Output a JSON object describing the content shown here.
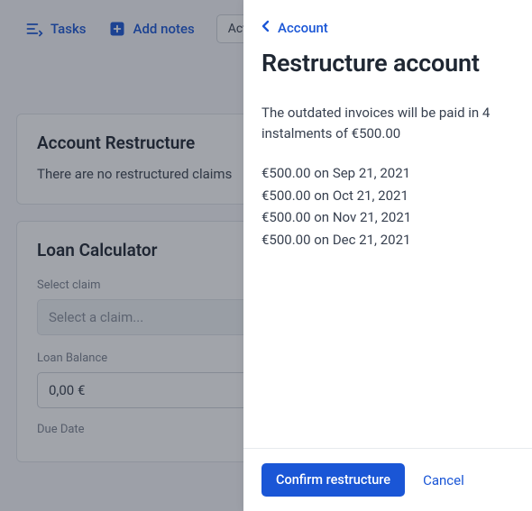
{
  "topbar": {
    "tasks_label": "Tasks",
    "add_notes_label": "Add notes",
    "action_label": "Act"
  },
  "restructure_card": {
    "title": "Account Restructure",
    "empty": "There are no restructured claims"
  },
  "loan_card": {
    "title": "Loan Calculator",
    "select_claim_label": "Select claim",
    "select_claim_placeholder": "Select a claim...",
    "loan_balance_label": "Loan Balance",
    "loan_balance_value": "0,00 €",
    "due_date_label": "Due Date"
  },
  "panel": {
    "breadcrumb": "Account",
    "title": "Restructure account",
    "description": "The outdated invoices will be paid in 4 instalments of €500.00",
    "schedule": [
      "€500.00 on Sep 21, 2021",
      "€500.00 on Oct 21, 2021",
      "€500.00 on Nov 21, 2021",
      "€500.00 on Dec 21, 2021"
    ],
    "confirm_label": "Confirm restructure",
    "cancel_label": "Cancel"
  }
}
